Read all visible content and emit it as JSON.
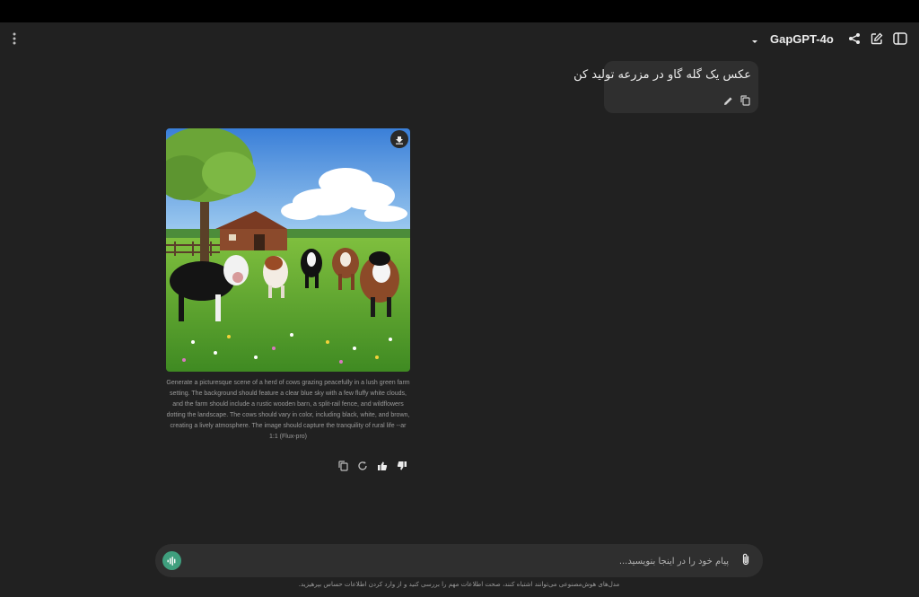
{
  "header": {
    "model_name": "GapGPT-4o"
  },
  "conversation": {
    "user_message": "عکس یک گله گاو در مزرعه تولید کن",
    "assistant_caption": "Generate a picturesque scene of a herd of cows grazing peacefully in a lush green farm setting. The background should feature a clear blue sky with a few fluffy white clouds, and the farm should include a rustic wooden barn, a split-rail fence, and wildflowers dotting the landscape. The cows should vary in color, including black, white, and brown, creating a lively atmosphere. The image should capture the tranquility of rural life --ar 1:1 (Flux-pro)"
  },
  "composer": {
    "placeholder": "پیام خود را در اینجا بنویسید..."
  },
  "footer": {
    "disclaimer": "مدل‌های هوش‌مصنوعی می‌توانند اشتباه کنند، صحت اطلاعات مهم را بررسی کنید و از وارد کردن اطلاعات حساس بپرهیزید."
  },
  "icons": {
    "menu": "vertical-dots-icon",
    "share": "share-icon",
    "new_chat": "edit-icon",
    "sidebar": "sidebar-toggle-icon",
    "download": "download-icon",
    "copy": "copy-icon",
    "regenerate": "refresh-icon",
    "like": "thumbs-up-icon",
    "dislike": "thumbs-down-icon",
    "voice": "voice-wave-icon",
    "attach": "paperclip-icon"
  },
  "colors": {
    "background": "#212121",
    "bubble": "#2f2f2f",
    "accent_green": "#3f9f7e",
    "top_bar": "#000000"
  }
}
